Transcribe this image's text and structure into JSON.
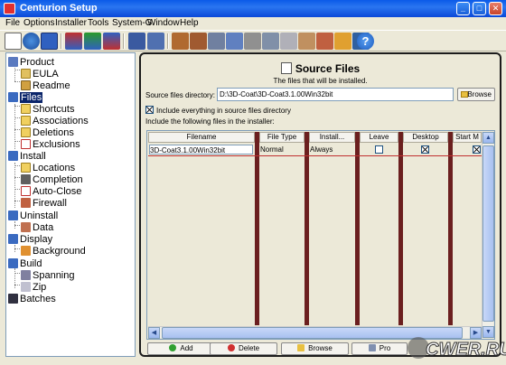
{
  "window": {
    "title": "Centurion Setup"
  },
  "menu": [
    "File",
    "Options",
    "Installer",
    "Tools",
    "System-G",
    "Window",
    "Help"
  ],
  "toolbar_icons": [
    "new-icon",
    "open-globe-icon",
    "save-icon",
    "build-icon",
    "upload-icon",
    "download-icon",
    "run-icon",
    "test-icon",
    "package-icon",
    "package-open-icon",
    "disk-icon",
    "wizard-icon",
    "key-icon",
    "merge-icon",
    "copy-icon",
    "handshake-icon",
    "pen-icon",
    "tools-icon",
    "settings-icon",
    "help-icon"
  ],
  "tree": {
    "product": "Product",
    "eula": "EULA",
    "readme": "Readme",
    "files": "Files",
    "shortcuts": "Shortcuts",
    "associations": "Associations",
    "deletions": "Deletions",
    "exclusions": "Exclusions",
    "install": "Install",
    "locations": "Locations",
    "completion": "Completion",
    "autoclose": "Auto-Close",
    "firewall": "Firewall",
    "uninstall": "Uninstall",
    "data": "Data",
    "display": "Display",
    "background": "Background",
    "build": "Build",
    "spanning": "Spanning",
    "zip": "Zip",
    "batches": "Batches"
  },
  "panel": {
    "title": "Source Files",
    "subtitle": "The files that will be installed.",
    "dir_label": "Source files directory:",
    "dir_value": "D:\\3D-Coat\\3D-Coat3.1.00Win32bit",
    "browse_label": "Browse",
    "include_all_label": "Include everything in source files directory",
    "include_all_checked": true,
    "include_label": "Include the following files in the installer:"
  },
  "table": {
    "columns": [
      "Filename",
      "File Type",
      "Install...",
      "Leave",
      "Desktop",
      "Start M"
    ],
    "rows": [
      {
        "filename": "3D-Coat3.1.00Win32bit",
        "file_type": "Normal",
        "install": "Always",
        "leave": false,
        "desktop": true,
        "start_menu": true
      }
    ]
  },
  "buttons": {
    "add": "Add",
    "delete": "Delete",
    "browse": "Browse",
    "properties": "Pro"
  },
  "watermark": "CWER.RU"
}
